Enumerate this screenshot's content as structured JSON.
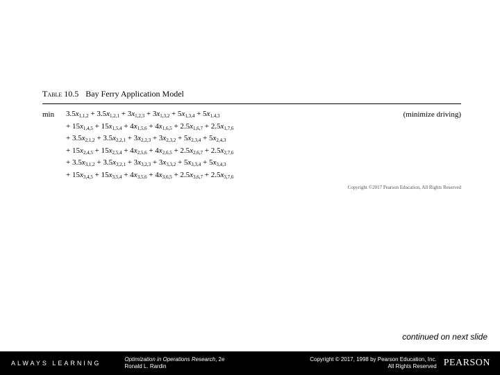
{
  "table": {
    "number": "Table 10.5",
    "title": "Bay Ferry Application Model",
    "obj_label": "min",
    "obj_note": "(minimize driving)",
    "rows": [
      [
        {
          "c": "3.5",
          "s": "1,1,2",
          "lead": ""
        },
        {
          "c": "3.5",
          "s": "1,2,1",
          "lead": "+ "
        },
        {
          "c": "3",
          "s": "1,2,3",
          "lead": "+ "
        },
        {
          "c": "3",
          "s": "1,3,2",
          "lead": "+ "
        },
        {
          "c": "5",
          "s": "1,3,4",
          "lead": "+ "
        },
        {
          "c": "5",
          "s": "1,4,3",
          "lead": "+ "
        }
      ],
      [
        {
          "c": "15",
          "s": "1,4,5",
          "lead": "+ "
        },
        {
          "c": "15",
          "s": "1,5,4",
          "lead": "+ "
        },
        {
          "c": "4",
          "s": "1,5,6",
          "lead": "+ "
        },
        {
          "c": "4",
          "s": "1,6,5",
          "lead": "+ "
        },
        {
          "c": "2.5",
          "s": "1,6,7",
          "lead": "+ "
        },
        {
          "c": "2.5",
          "s": "1,7,6",
          "lead": "+ "
        }
      ],
      [
        {
          "c": "3.5",
          "s": "2,1,2",
          "lead": "+ "
        },
        {
          "c": "3.5",
          "s": "2,2,1",
          "lead": "+ "
        },
        {
          "c": "3",
          "s": "2,2,3",
          "lead": "+ "
        },
        {
          "c": "3",
          "s": "2,3,2",
          "lead": "+ "
        },
        {
          "c": "5",
          "s": "2,3,4",
          "lead": "+ "
        },
        {
          "c": "5",
          "s": "2,4,3",
          "lead": "+ "
        }
      ],
      [
        {
          "c": "15",
          "s": "2,4,5",
          "lead": "+ "
        },
        {
          "c": "15",
          "s": "2,5,4",
          "lead": "+ "
        },
        {
          "c": "4",
          "s": "2,5,6",
          "lead": "+ "
        },
        {
          "c": "4",
          "s": "2,6,5",
          "lead": "+ "
        },
        {
          "c": "2.5",
          "s": "2,6,7",
          "lead": "+ "
        },
        {
          "c": "2.5",
          "s": "2,7,6",
          "lead": "+ "
        }
      ],
      [
        {
          "c": "3.5",
          "s": "3,1,2",
          "lead": "+ "
        },
        {
          "c": "3.5",
          "s": "3,2,1",
          "lead": "+ "
        },
        {
          "c": "3",
          "s": "3,2,3",
          "lead": "+ "
        },
        {
          "c": "3",
          "s": "3,3,2",
          "lead": "+ "
        },
        {
          "c": "5",
          "s": "3,3,4",
          "lead": "+ "
        },
        {
          "c": "5",
          "s": "3,4,3",
          "lead": "+ "
        }
      ],
      [
        {
          "c": "15",
          "s": "3,4,5",
          "lead": "+ "
        },
        {
          "c": "15",
          "s": "3,5,4",
          "lead": "+ "
        },
        {
          "c": "4",
          "s": "3,5,6",
          "lead": "+ "
        },
        {
          "c": "4",
          "s": "3,6,5",
          "lead": "+ "
        },
        {
          "c": "2.5",
          "s": "3,6,7",
          "lead": "+ "
        },
        {
          "c": "2.5",
          "s": "3,7,6",
          "lead": "+ "
        }
      ]
    ],
    "under_copy": "Copyright ©2017 Pearson Education, All Rights Reserved"
  },
  "continued": "continued on next slide",
  "footer": {
    "always_learning": "ALWAYS LEARNING",
    "book_title": "Optimization in Operations Research",
    "book_edition": ", 2e",
    "book_author": "Ronald L. Rardin",
    "copyright_line1": "Copyright © 2017, 1998 by Pearson Education, Inc.",
    "copyright_line2": "All Rights Reserved",
    "logo": "PEARSON"
  }
}
